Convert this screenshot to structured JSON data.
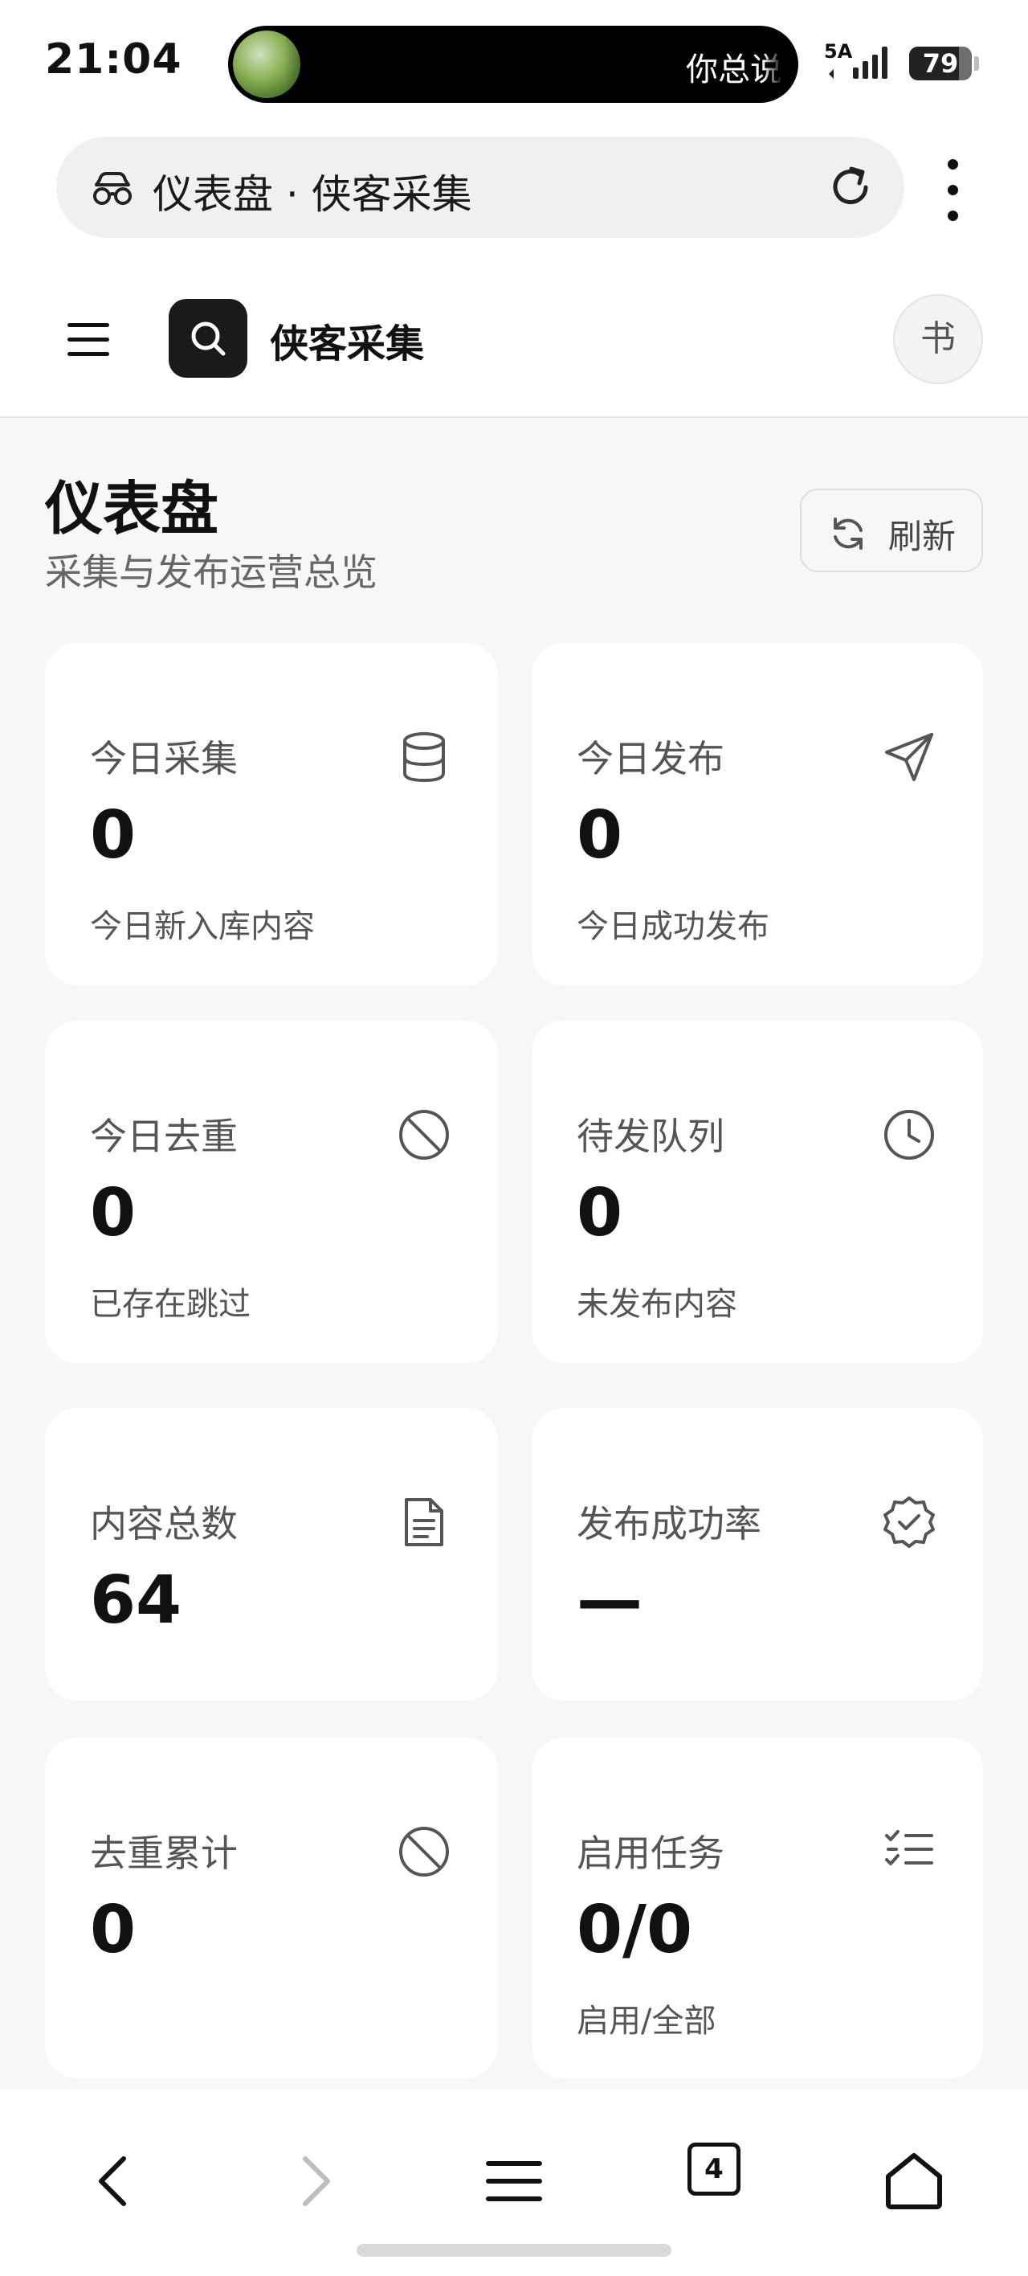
{
  "status_bar": {
    "time": "21:04",
    "notification_text": "你总说",
    "signal_label": "5A",
    "battery_level": "79"
  },
  "browser": {
    "url_title": "仪表盘 · 侠客采集",
    "icons": {
      "site": "incognito-glasses-icon",
      "reload": "reload-icon",
      "menu": "kebab-menu-icon"
    }
  },
  "app_header": {
    "brand": "侠客采集",
    "avatar_initial": "书",
    "icons": {
      "menu": "hamburger-menu-icon",
      "logo": "search-icon"
    }
  },
  "page": {
    "title": "仪表盘",
    "subtitle": "采集与发布运营总览",
    "refresh_label": "刷新"
  },
  "stats": [
    {
      "label": "今日采集",
      "value": "0",
      "sub": "今日新入库内容",
      "icon": "database-icon"
    },
    {
      "label": "今日发布",
      "value": "0",
      "sub": "今日成功发布",
      "icon": "send-icon"
    },
    {
      "label": "今日去重",
      "value": "0",
      "sub": "已存在跳过",
      "icon": "ban-icon"
    },
    {
      "label": "待发队列",
      "value": "0",
      "sub": "未发布内容",
      "icon": "clock-icon"
    },
    {
      "label": "内容总数",
      "value": "64",
      "sub": "",
      "icon": "document-icon"
    },
    {
      "label": "发布成功率",
      "value": "—",
      "sub": "",
      "icon": "verified-badge-icon"
    },
    {
      "label": "去重累计",
      "value": "0",
      "sub": "",
      "icon": "ban-icon"
    },
    {
      "label": "启用任务",
      "value": "0/0",
      "sub": "启用/全部",
      "icon": "checklist-icon"
    }
  ],
  "bottom_nav": {
    "tab_count": "4",
    "icons": [
      "back-icon",
      "forward-icon",
      "menu-icon",
      "tabs-icon",
      "home-icon"
    ]
  },
  "colors": {
    "card_bg": "#ffffff",
    "page_bg": "#f7f7f7",
    "text_primary": "#111111",
    "text_secondary": "#555555"
  }
}
